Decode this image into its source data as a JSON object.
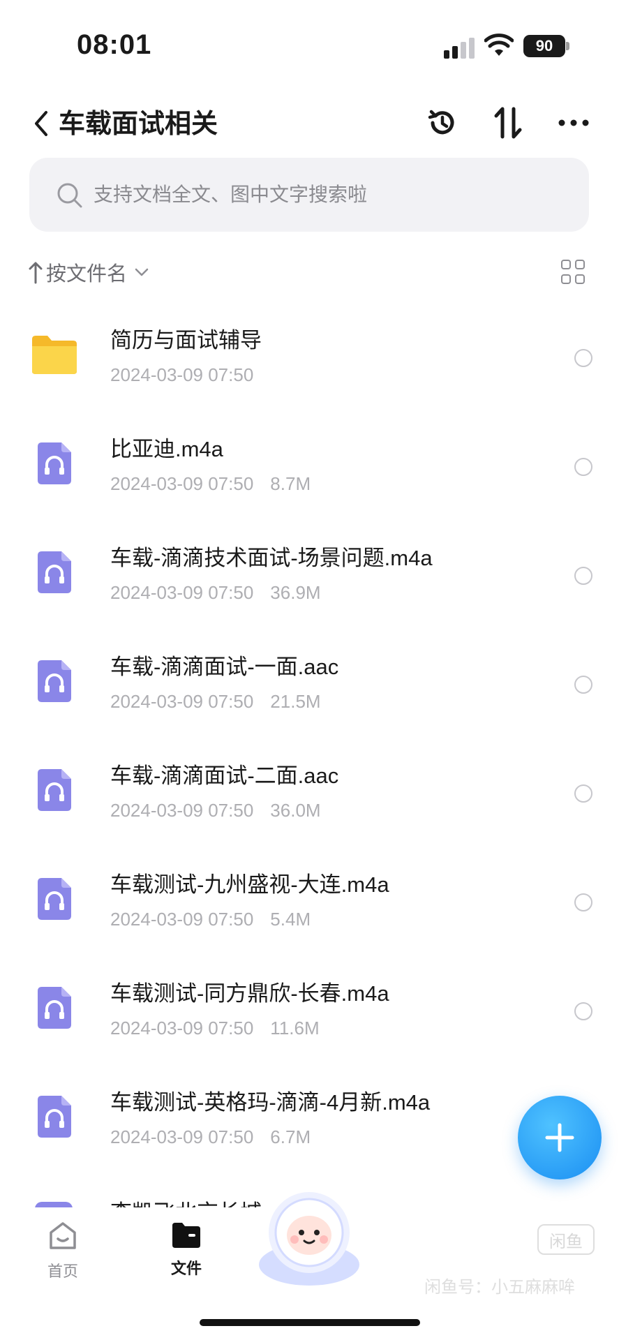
{
  "status_bar": {
    "time": "08:01",
    "battery": "90"
  },
  "header": {
    "title": "车载面试相关",
    "icons": [
      "back-chevron-icon",
      "history-icon",
      "sort-icon",
      "more-icon"
    ]
  },
  "search": {
    "placeholder": "支持文档全文、图中文字搜索啦"
  },
  "sort": {
    "label": "按文件名"
  },
  "files": [
    {
      "type": "folder",
      "name": "简历与面试辅导",
      "date": "2024-03-09 07:50",
      "size": ""
    },
    {
      "type": "audio",
      "name": "比亚迪.m4a",
      "date": "2024-03-09 07:50",
      "size": "8.7M"
    },
    {
      "type": "audio",
      "name": "车载-滴滴技术面试-场景问题.m4a",
      "date": "2024-03-09 07:50",
      "size": "36.9M"
    },
    {
      "type": "audio",
      "name": "车载-滴滴面试-一面.aac",
      "date": "2024-03-09 07:50",
      "size": "21.5M"
    },
    {
      "type": "audio",
      "name": "车载-滴滴面试-二面.aac",
      "date": "2024-03-09 07:50",
      "size": "36.0M"
    },
    {
      "type": "audio",
      "name": "车载测试-九州盛视-大连.m4a",
      "date": "2024-03-09 07:50",
      "size": "5.4M"
    },
    {
      "type": "audio",
      "name": "车载测试-同方鼎欣-长春.m4a",
      "date": "2024-03-09 07:50",
      "size": "11.6M"
    },
    {
      "type": "audio",
      "name": "车载测试-英格玛-滴滴-4月新.m4a",
      "date": "2024-03-09 07:50",
      "size": "6.7M"
    }
  ],
  "partial_file": {
    "name": "李凯飞北京长城"
  },
  "tabs": {
    "home": "首页",
    "files": "文件"
  },
  "watermark": {
    "badge": "闲鱼",
    "text": "闲鱼号：小五麻麻哞"
  },
  "colors": {
    "accent": "#1a8ef2",
    "audio_icon": "#8a86e8",
    "folder": "#f6c936"
  }
}
